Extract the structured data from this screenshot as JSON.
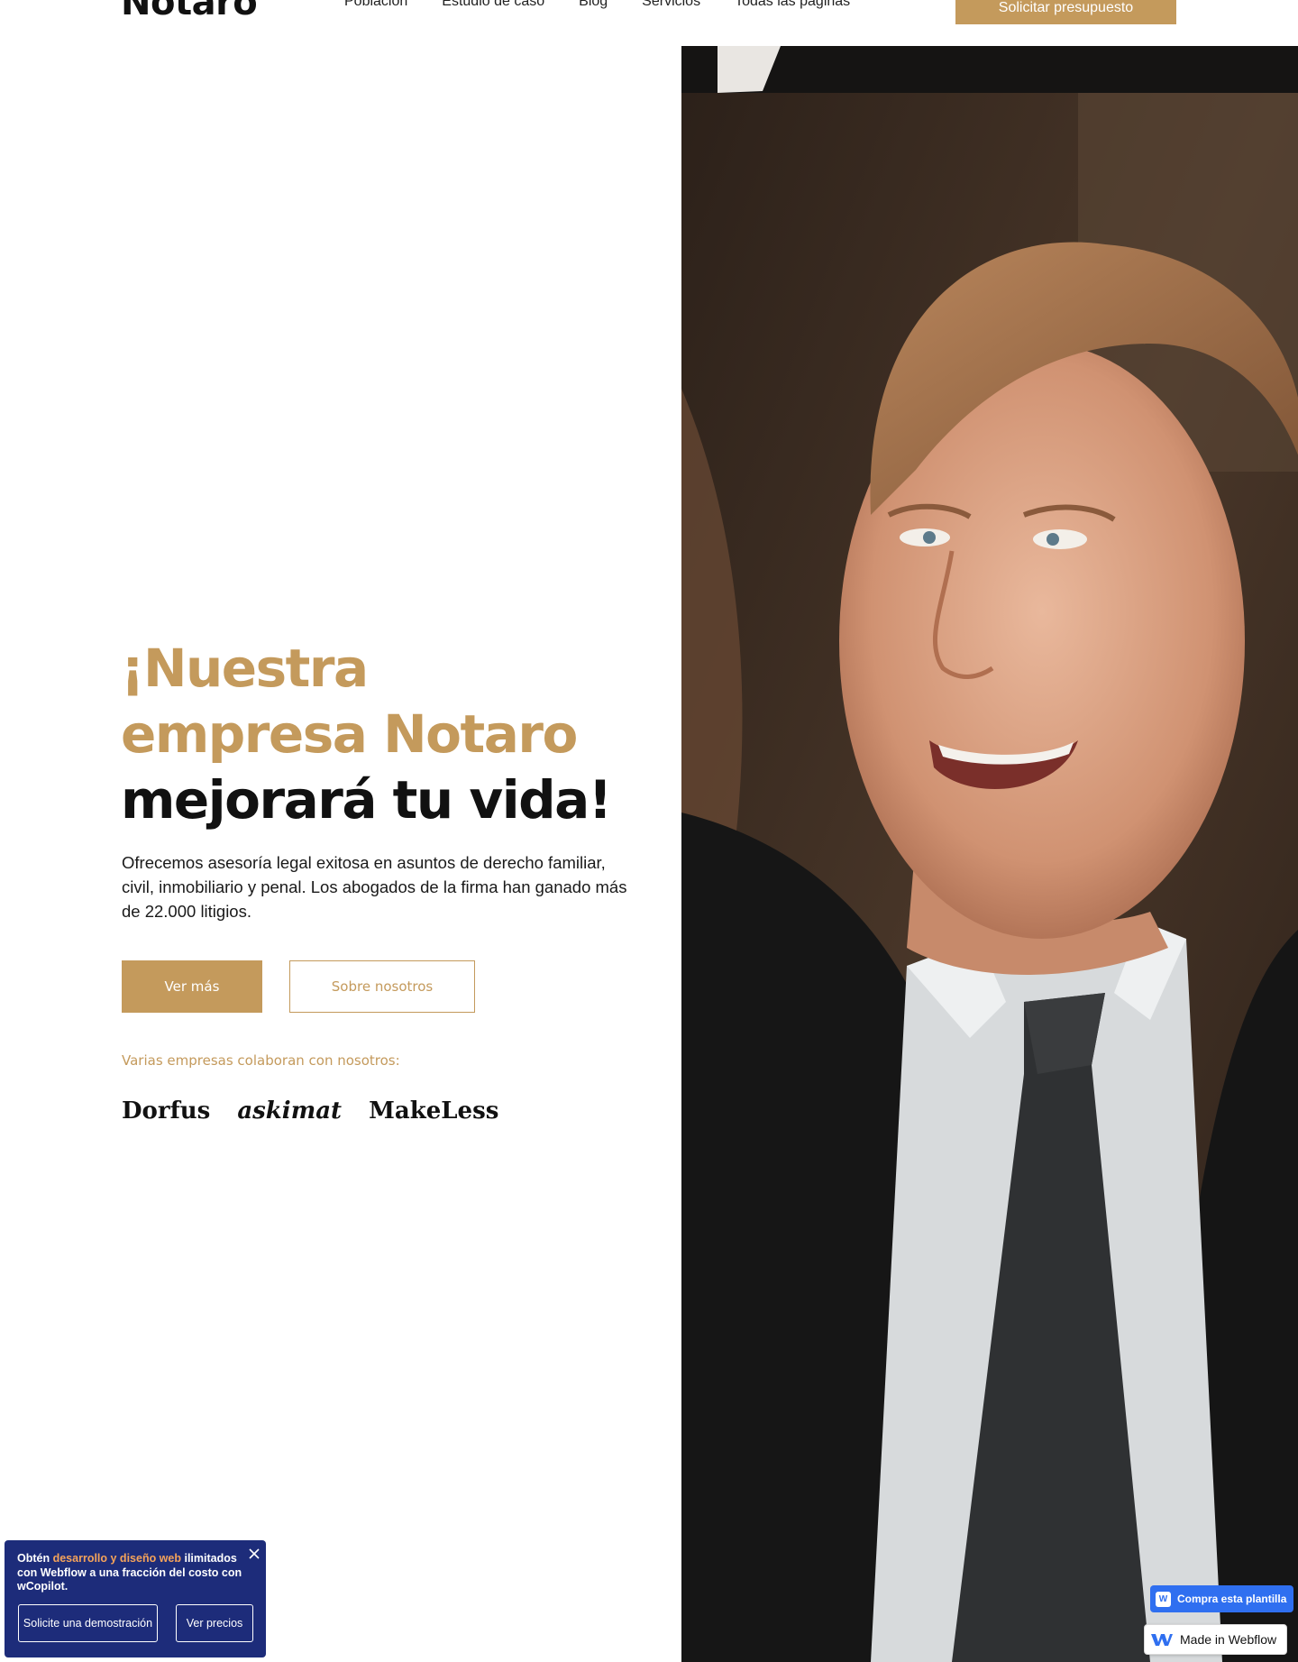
{
  "nav": {
    "logo": "Notaro",
    "links": [
      "Población",
      "Estudio de caso",
      "Blog",
      "Servicios",
      "Todas las páginas"
    ],
    "cta": "Solicitar presupuesto"
  },
  "hero": {
    "headline_accent": "¡Nuestra empresa Notaro",
    "headline_rest": " mejorará tu vida!",
    "lead": "Ofrecemos asesoría legal exitosa en asuntos de derecho familiar, civil, inmobiliario y penal. Los abogados de la firma han ganado más de 22.000 litigios.",
    "primary_button": "Ver más",
    "secondary_button": "Sobre nosotros",
    "partners_label": "Varias empresas colaboran con nosotros:",
    "partners": [
      "Dorfus",
      "askimat",
      "MakeLess"
    ]
  },
  "promo": {
    "text_prefix": "Obtén ",
    "text_highlight": "desarrollo y diseño web",
    "text_suffix": " ilimitados con Webflow a una fracción del costo con wCopilot.",
    "button_demo": "Solicite una demostración",
    "button_prices": "Ver precios",
    "close_icon": "close-icon"
  },
  "badges": {
    "buy_template": "Compra esta plantilla",
    "made_in": "Made in Webflow"
  },
  "colors": {
    "accent": "#c49a5c",
    "promo_bg": "#1d2c7a",
    "promo_highlight": "#f5a35a",
    "badge_blue": "#2f6ff0"
  }
}
